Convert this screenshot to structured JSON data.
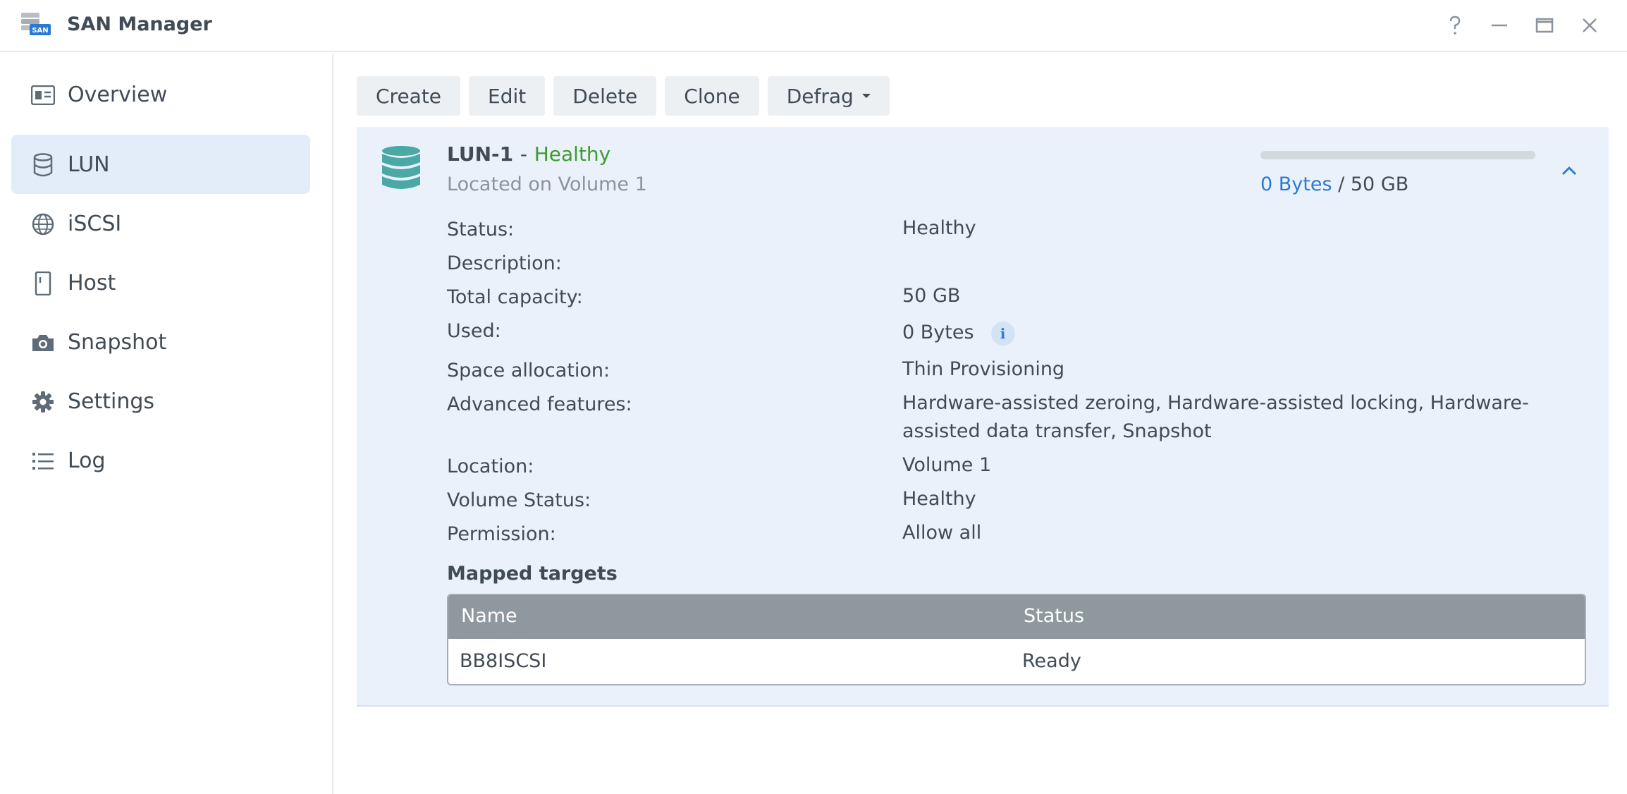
{
  "window": {
    "title": "SAN Manager",
    "icon_badge": "SAN"
  },
  "sidebar": {
    "items": [
      {
        "label": "Overview",
        "icon": "overview-card-icon",
        "active": false
      },
      {
        "label": "LUN",
        "icon": "database-icon",
        "active": true
      },
      {
        "label": "iSCSI",
        "icon": "globe-icon",
        "active": false
      },
      {
        "label": "Host",
        "icon": "server-icon",
        "active": false
      },
      {
        "label": "Snapshot",
        "icon": "camera-icon",
        "active": false
      },
      {
        "label": "Settings",
        "icon": "gear-icon",
        "active": false
      },
      {
        "label": "Log",
        "icon": "list-icon",
        "active": false
      }
    ]
  },
  "toolbar": {
    "create": "Create",
    "edit": "Edit",
    "delete": "Delete",
    "clone": "Clone",
    "defrag": "Defrag"
  },
  "lun": {
    "name": "LUN-1",
    "separator": "-",
    "health": "Healthy",
    "location_line": "Located on Volume 1",
    "usage": {
      "used": "0 Bytes",
      "separator": "/",
      "total": "50 GB",
      "fraction": 0
    },
    "details": [
      {
        "label": "Status:",
        "value": "Healthy",
        "status": true
      },
      {
        "label": "Description:",
        "value": ""
      },
      {
        "label": "Total capacity:",
        "value": "50 GB"
      },
      {
        "label": "Used:",
        "value": "0 Bytes",
        "info": true
      },
      {
        "label": "Space allocation:",
        "value": "Thin Provisioning"
      },
      {
        "label": "Advanced features:",
        "value": "Hardware-assisted zeroing, Hardware-assisted locking, Hardware-assisted data transfer, Snapshot"
      },
      {
        "label": "Location:",
        "value": "Volume 1"
      },
      {
        "label": "Volume Status:",
        "value": "Healthy",
        "status": true
      },
      {
        "label": "Permission:",
        "value": "Allow all"
      }
    ],
    "mapped_targets": {
      "title": "Mapped targets",
      "columns": [
        "Name",
        "Status"
      ],
      "rows": [
        {
          "name": "BB8ISCSI",
          "status": "Ready"
        }
      ]
    }
  },
  "colors": {
    "accent": "#2a79d4",
    "healthy": "#3f9b2c",
    "panel_bg": "#eaf1fb",
    "active_nav": "#e3ecf9",
    "lun_icon": "#4aa8a5"
  }
}
